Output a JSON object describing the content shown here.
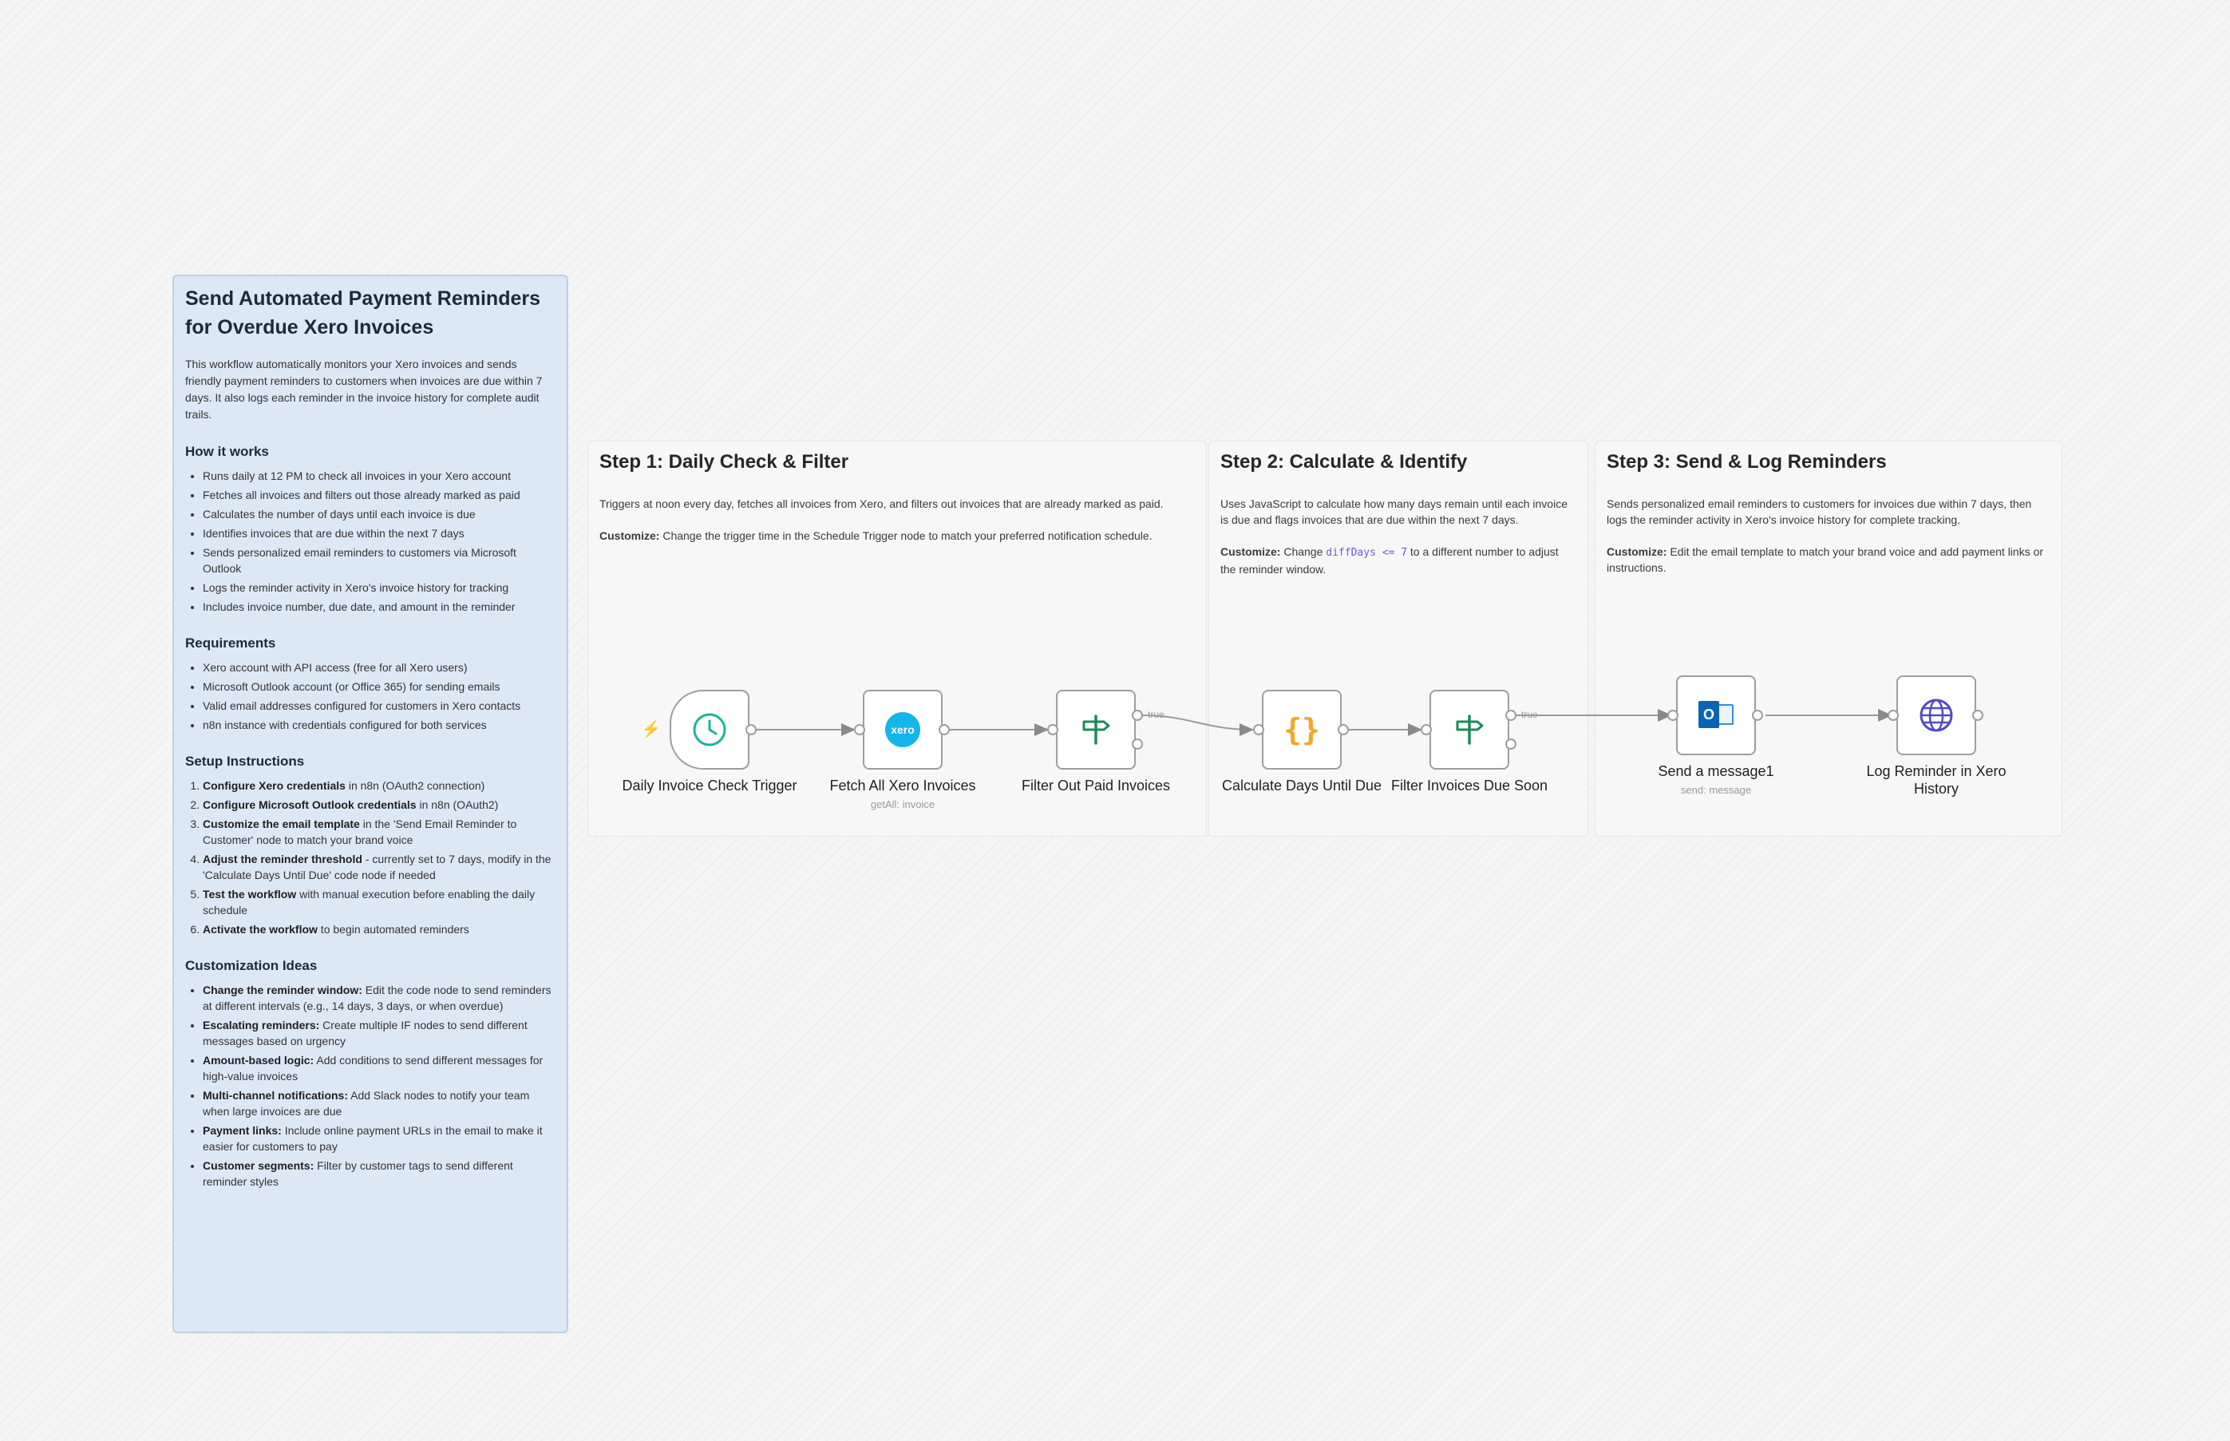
{
  "main_note": {
    "title": "Send Automated Payment Reminders for Overdue Xero Invoices",
    "intro": "This workflow automatically monitors your Xero invoices and sends friendly payment reminders to customers when invoices are due within 7 days. It also logs each reminder in the invoice history for complete audit trails.",
    "how_heading": "How it works",
    "how_items": [
      "Runs daily at 12 PM to check all invoices in your Xero account",
      "Fetches all invoices and filters out those already marked as paid",
      "Calculates the number of days until each invoice is due",
      "Identifies invoices that are due within the next 7 days",
      "Sends personalized email reminders to customers via Microsoft Outlook",
      "Logs the reminder activity in Xero's invoice history for tracking",
      "Includes invoice number, due date, and amount in the reminder"
    ],
    "req_heading": "Requirements",
    "req_items": [
      "Xero account with API access (free for all Xero users)",
      "Microsoft Outlook account (or Office 365) for sending emails",
      "Valid email addresses configured for customers in Xero contacts",
      "n8n instance with credentials configured for both services"
    ],
    "setup_heading": "Setup Instructions",
    "setup_items": [
      {
        "bold": "Configure Xero credentials",
        "text": " in n8n (OAuth2 connection)"
      },
      {
        "bold": "Configure Microsoft Outlook credentials",
        "text": " in n8n (OAuth2)"
      },
      {
        "bold": "Customize the email template",
        "text": " in the 'Send Email Reminder to Customer' node to match your brand voice"
      },
      {
        "bold": "Adjust the reminder threshold",
        "text": " - currently set to 7 days, modify in the 'Calculate Days Until Due' code node if needed"
      },
      {
        "bold": "Test the workflow",
        "text": " with manual execution before enabling the daily schedule"
      },
      {
        "bold": "Activate the workflow",
        "text": " to begin automated reminders"
      }
    ],
    "custom_heading": "Customization Ideas",
    "custom_items": [
      {
        "bold": "Change the reminder window:",
        "text": " Edit the code node to send reminders at different intervals (e.g., 14 days, 3 days, or when overdue)"
      },
      {
        "bold": "Escalating reminders:",
        "text": " Create multiple IF nodes to send different messages based on urgency"
      },
      {
        "bold": "Amount-based logic:",
        "text": " Add conditions to send different messages for high-value invoices"
      },
      {
        "bold": "Multi-channel notifications:",
        "text": " Add Slack nodes to notify your team when large invoices are due"
      },
      {
        "bold": "Payment links:",
        "text": " Include online payment URLs in the email to make it easier for customers to pay"
      },
      {
        "bold": "Customer segments:",
        "text": " Filter by customer tags to send different reminder styles"
      }
    ]
  },
  "steps": [
    {
      "title": "Step 1: Daily Check & Filter",
      "desc": "Triggers at noon every day, fetches all invoices from Xero, and filters out invoices that are already marked as paid.",
      "customize_label": "Customize:",
      "customize_text": " Change the trigger time in the Schedule Trigger node to match your preferred notification schedule."
    },
    {
      "title": "Step 2: Calculate & Identify",
      "desc": "Uses JavaScript to calculate how many days remain until each invoice is due and flags invoices that are due within the next 7 days.",
      "customize_label": "Customize:",
      "customize_pre": " Change ",
      "customize_code": "diffDays <= 7",
      "customize_post": " to a different number to adjust the reminder window."
    },
    {
      "title": "Step 3: Send & Log Reminders",
      "desc": "Sends personalized email reminders to customers for invoices due within 7 days, then logs the reminder activity in Xero's invoice history for complete tracking.",
      "customize_label": "Customize:",
      "customize_text": " Edit the email template to match your brand voice and add payment links or instructions."
    }
  ],
  "nodes": {
    "trigger": {
      "label": "Daily Invoice Check Trigger",
      "icon": "clock-icon"
    },
    "fetch": {
      "label": "Fetch All Xero Invoices",
      "sub": "getAll: invoice",
      "icon_text": "xero"
    },
    "filter_paid": {
      "label": "Filter Out Paid Invoices",
      "icon": "signpost-icon"
    },
    "calc": {
      "label": "Calculate Days Until Due",
      "icon_text": "{}"
    },
    "filter_soon": {
      "label": "Filter Invoices Due Soon",
      "icon": "signpost-icon"
    },
    "send": {
      "label": "Send a message1",
      "sub": "send: message",
      "icon_text": "O"
    },
    "log": {
      "label": "Log Reminder in Xero History",
      "icon": "globe-icon"
    }
  },
  "edges": {
    "true_label": "true"
  },
  "colors": {
    "note_bg": "#dde8f6",
    "trigger_accent": "#ff6d5a",
    "xero": "#13b5ea",
    "code": "#f5a623",
    "if": "#1e8a58",
    "outlook": "#0a64b4",
    "http": "#5449c7"
  }
}
